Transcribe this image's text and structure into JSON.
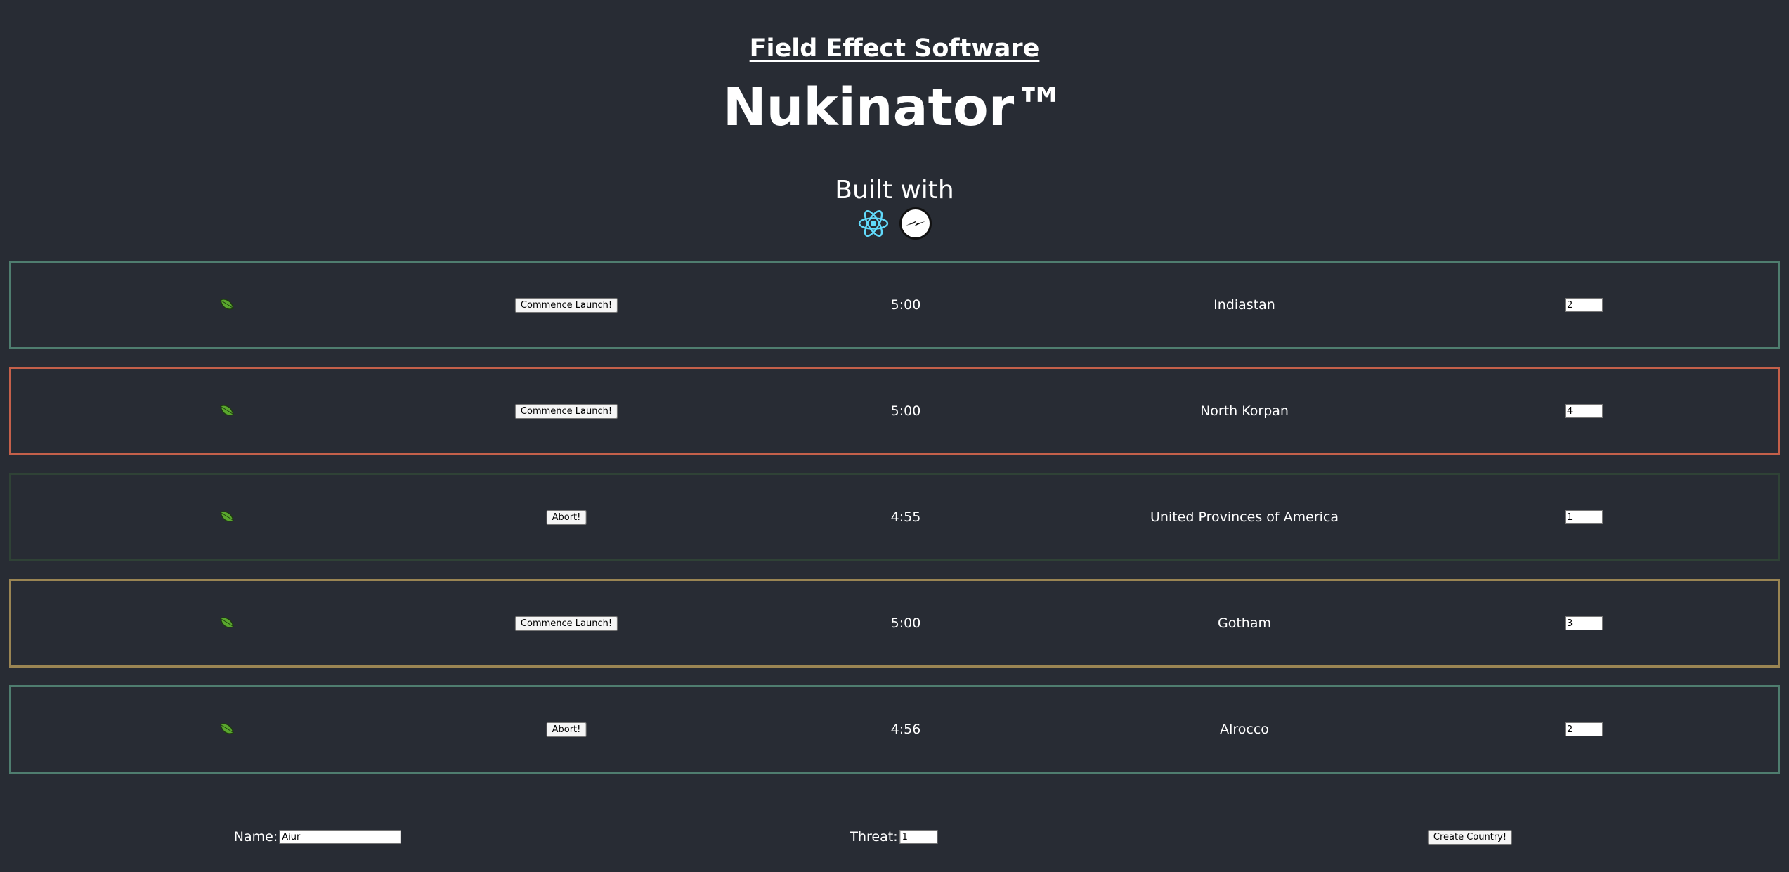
{
  "header": {
    "company": "Field Effect Software",
    "product": "Nukinator™",
    "built_with": "Built with",
    "logos": [
      "react-logo",
      "socket-io-logo"
    ]
  },
  "countries": [
    {
      "launch_button": "Commence Launch!",
      "timer": "5:00",
      "name": "Indiastan",
      "threat": "2",
      "border_color": "#4f7d6f"
    },
    {
      "launch_button": "Commence Launch!",
      "timer": "5:00",
      "name": "North Korpan",
      "threat": "4",
      "border_color": "#c4604a"
    },
    {
      "launch_button": "Abort!",
      "timer": "4:55",
      "name": "United Provinces of America",
      "threat": "1",
      "border_color": "#2f4236"
    },
    {
      "launch_button": "Commence Launch!",
      "timer": "5:00",
      "name": "Gotham",
      "threat": "3",
      "border_color": "#9a8553"
    },
    {
      "launch_button": "Abort!",
      "timer": "4:56",
      "name": "Alrocco",
      "threat": "2",
      "border_color": "#4f7d6f"
    }
  ],
  "form": {
    "name_label": "Name:",
    "name_value": "Aiur",
    "threat_label": "Threat:",
    "threat_value": "1",
    "create_button": "Create Country!"
  },
  "colors": {
    "background": "#282c34",
    "leaf_green": "#5aa72e",
    "react_blue": "#61dafb"
  }
}
